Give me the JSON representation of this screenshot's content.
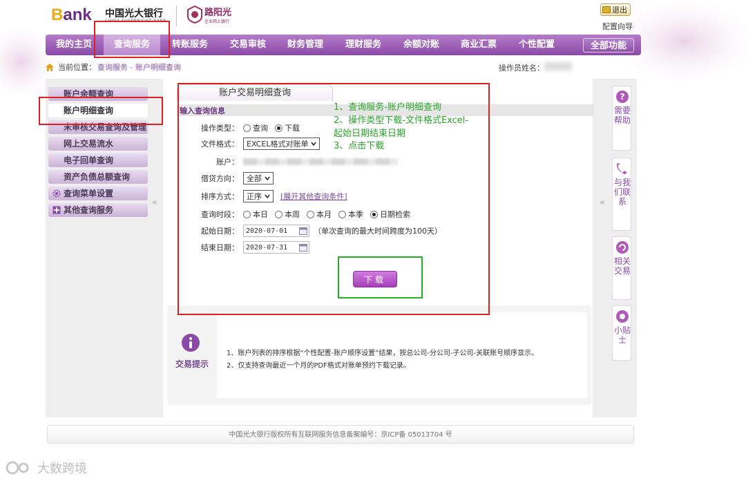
{
  "colors": {
    "brand_purple": "#8a4aa6",
    "annotation_red": "#e02020",
    "annotation_green": "#22b022"
  },
  "header": {
    "logo_b": "B",
    "logo_rest": "ank",
    "bank_name_cn": "中国光大银行",
    "bank_name_en": "CHINA EVERBRIGHT BANK",
    "product_name": "路阳光",
    "product_sub": "企业网上银行",
    "logout_label": "退出",
    "config_label": "配置向导"
  },
  "nav": {
    "items": [
      {
        "label": "我的主页",
        "active": false
      },
      {
        "label": "查询服务",
        "active": true
      },
      {
        "label": "转账服务",
        "active": false
      },
      {
        "label": "交易审核",
        "active": false
      },
      {
        "label": "财务管理",
        "active": false
      },
      {
        "label": "理财服务",
        "active": false
      },
      {
        "label": "余额对账",
        "active": false
      },
      {
        "label": "商业汇票",
        "active": false
      },
      {
        "label": "个性配置",
        "active": false
      }
    ],
    "all_functions": "全部功能"
  },
  "breadcrumb": {
    "prefix": "当前位置：",
    "path": "查询服务 - 账户明细查询",
    "operator_label": "操作员姓名："
  },
  "sidebar": {
    "items": [
      {
        "label": "账户余额查询",
        "active": false,
        "icon": ""
      },
      {
        "label": "账户明细查询",
        "active": true,
        "icon": ""
      },
      {
        "label": "未审核交易查询及管理",
        "active": false,
        "icon": ""
      },
      {
        "label": "网上交易流水",
        "active": false,
        "icon": ""
      },
      {
        "label": "电子回单查询",
        "active": false,
        "icon": ""
      },
      {
        "label": "资产负债总额查询",
        "active": false,
        "icon": ""
      },
      {
        "label": "查询菜单设置",
        "active": false,
        "icon": "gear-icon"
      },
      {
        "label": "其他查询服务",
        "active": false,
        "icon": "plus-box-icon"
      }
    ],
    "collapse_glyph": "«"
  },
  "content": {
    "tab_title": "账户交易明细查询",
    "section_title": "输入查询信息",
    "form": {
      "op_type_label": "操作类型：",
      "op_type_options": [
        "查询",
        "下载"
      ],
      "op_type_selected": "下载",
      "file_format_label": "文件格式：",
      "file_format_value": "EXCEL格式对账单",
      "account_label": "账户：",
      "direction_label": "借贷方向：",
      "direction_value": "全部",
      "sort_label": "排序方式：",
      "sort_value": "正序",
      "more_conditions": "[展开其他查询条件]",
      "period_label": "查询时段：",
      "period_options": [
        "本日",
        "本周",
        "本月",
        "本季",
        "日期检索"
      ],
      "period_selected": "日期检索",
      "start_label": "起始日期：",
      "start_value": "2020-07-01",
      "range_note": "（单次查询的最大时间跨度为100天）",
      "end_label": "结束日期：",
      "end_value": "2020-07-31",
      "download_button": "下载"
    },
    "tips": {
      "label": "交易提示",
      "lines": [
        "1、账户列表的排序根据“个性配置-账户顺序设置”结果，按总公司-分公司-子公司-关联账号顺序显示。",
        "2、仅支持查询最近一个月的PDF格式对账单预约下载记录。"
      ]
    }
  },
  "right_panel": [
    {
      "label": "需要帮助",
      "icon": "question-icon"
    },
    {
      "label": "与我们联系",
      "icon": "phone-icon"
    },
    {
      "label": "相关交易",
      "icon": "refresh-icon"
    },
    {
      "label": "小贴士",
      "icon": "tip-icon"
    }
  ],
  "footer": "中国光大银行版权所有互联网服务信息备案编号：京ICP备 05013704 号",
  "annotations": {
    "lines": [
      "1、查询服务-账户明细查询",
      "2、操作类型下载-文件格式Excel-",
      "起始日期结束日期",
      "3、点击下载"
    ]
  },
  "watermark": "大数跨境"
}
